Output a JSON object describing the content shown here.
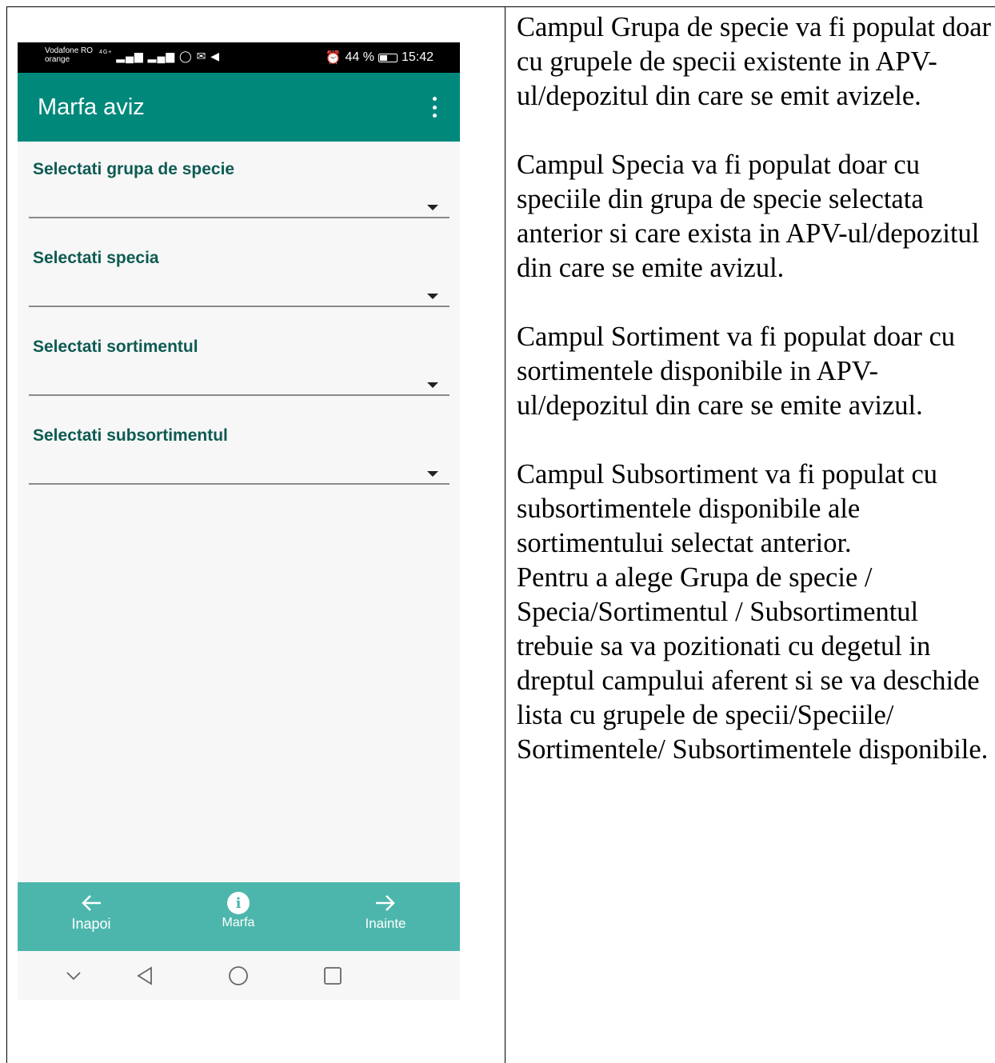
{
  "phone": {
    "status_bar": {
      "carrier_line1": "Vodafone RO",
      "carrier_line2": "orange",
      "network": "4G+",
      "battery_text": "44 %",
      "time": "15:42"
    },
    "app_bar": {
      "title": "Marfa aviz",
      "menu_icon": "overflow-menu-icon"
    },
    "fields": [
      {
        "label": "Selectati grupa de specie",
        "value": ""
      },
      {
        "label": "Selectati specia",
        "value": ""
      },
      {
        "label": "Selectati sortimentul",
        "value": ""
      },
      {
        "label": "Selectati subsortimentul",
        "value": ""
      }
    ],
    "bottom_nav": {
      "back_label": "Inapoi",
      "info_label": "Marfa",
      "next_label": "Inainte"
    },
    "colors": {
      "app_bar": "#00897b",
      "bottom_bar": "#4db6ac",
      "label": "#0d5b53"
    }
  },
  "document": {
    "paragraphs": [
      "Campul Grupa de specie va fi populat doar cu grupele de specii existente in APV-ul/depozitul din care se emit avizele.",
      "Campul Specia va fi populat doar cu speciile din grupa de specie selectata anterior si care exista in APV-ul/depozitul din care se emite avizul.",
      "Campul Sortiment va fi populat doar cu sortimentele disponibile in APV-ul/depozitul din care se emite avizul.",
      "Campul Subsortiment va fi populat cu subsortimentele disponibile ale sortimentului selectat anterior.",
      "Pentru a alege Grupa de specie / Specia/Sortimentul / Subsortimentul trebuie sa va pozitionati  cu degetul in dreptul campului aferent si se va deschide lista cu grupele de specii/Speciile/ Sortimentele/ Subsortimentele disponibile."
    ]
  }
}
